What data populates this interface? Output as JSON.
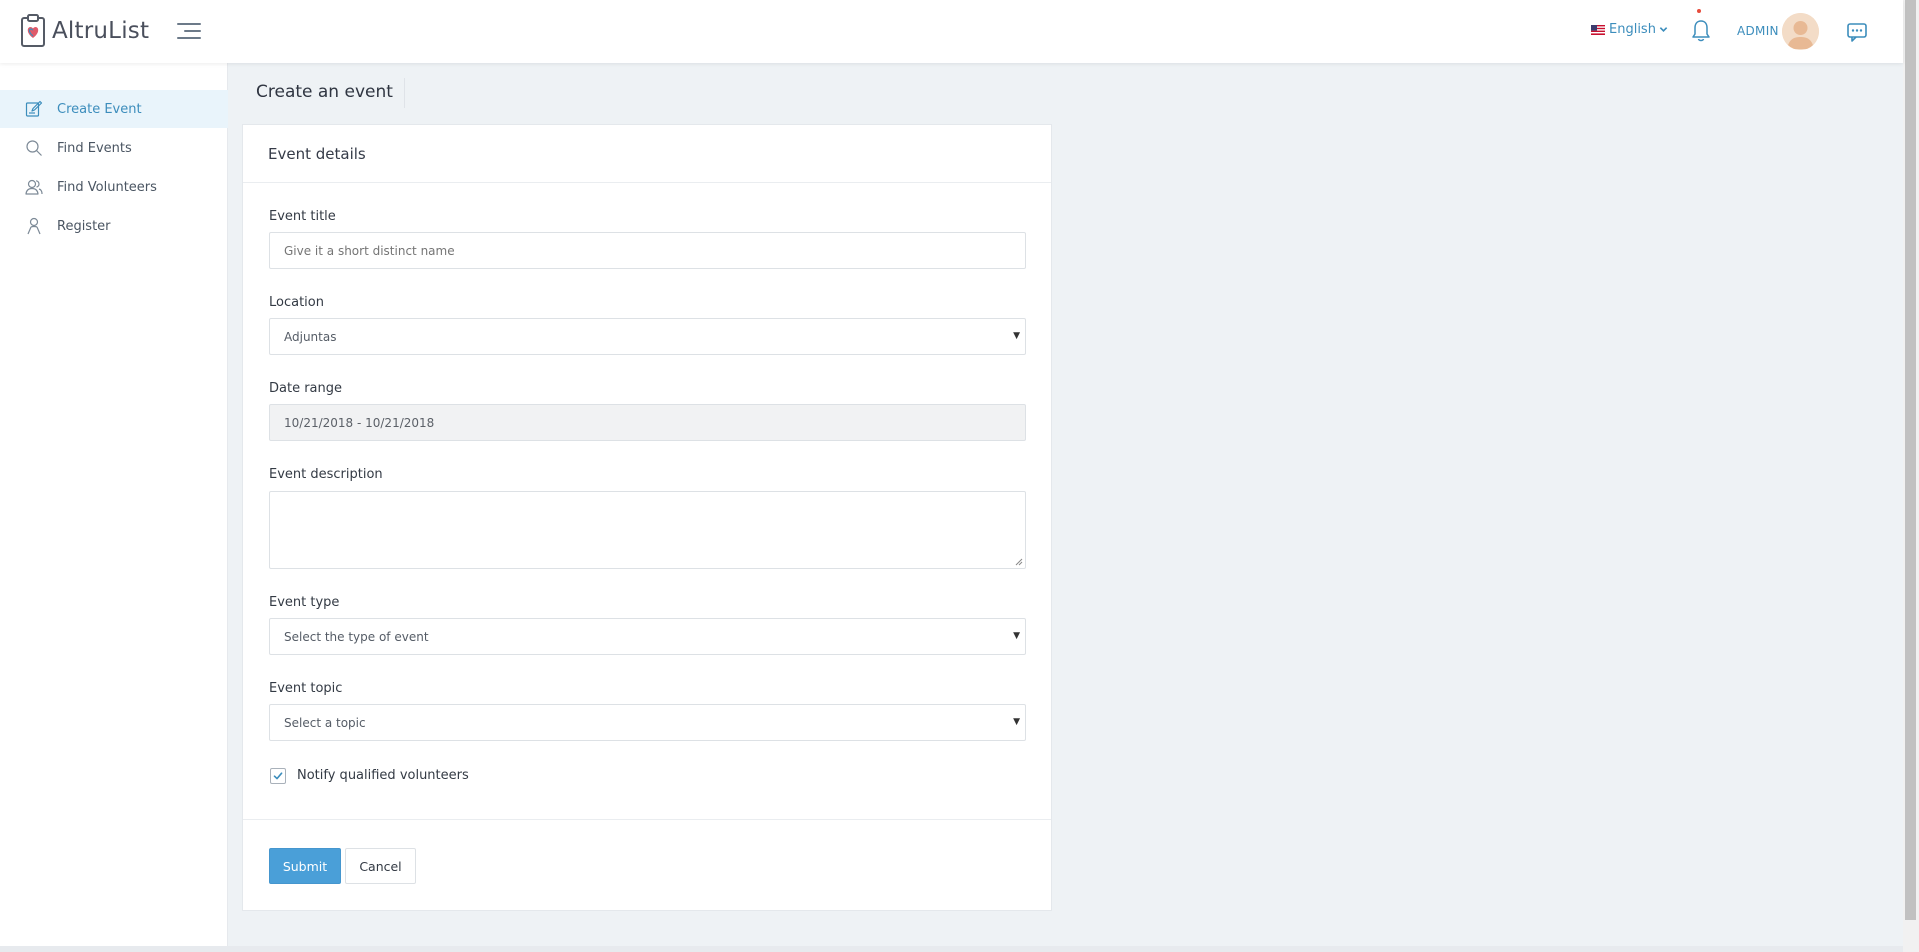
{
  "header": {
    "brand": "AltruList",
    "language": "English",
    "username": "ADMIN"
  },
  "sidebar": {
    "items": [
      {
        "label": "Create Event",
        "icon": "edit-icon",
        "active": true
      },
      {
        "label": "Find Events",
        "icon": "search-icon",
        "active": false
      },
      {
        "label": "Find Volunteers",
        "icon": "users-icon",
        "active": false
      },
      {
        "label": "Register",
        "icon": "user-icon",
        "active": false
      }
    ]
  },
  "page": {
    "title": "Create an event"
  },
  "form": {
    "card_title": "Event details",
    "event_title": {
      "label": "Event title",
      "value": "",
      "placeholder": "Give it a short distinct name"
    },
    "location": {
      "label": "Location",
      "value": "Adjuntas"
    },
    "date_range": {
      "label": "Date range",
      "value": "10/21/2018 - 10/21/2018"
    },
    "description": {
      "label": "Event description",
      "value": ""
    },
    "event_type": {
      "label": "Event type",
      "value": "Select the type of event"
    },
    "event_topic": {
      "label": "Event topic",
      "value": "Select a topic"
    },
    "notify": {
      "label": "Notify qualified volunteers",
      "checked": true
    },
    "submit_label": "Submit",
    "cancel_label": "Cancel"
  },
  "colors": {
    "accent": "#3c8dbc",
    "primary_button": "#4a9fd8",
    "active_nav_bg": "#e9f4fb",
    "page_bg": "#eef2f5"
  }
}
